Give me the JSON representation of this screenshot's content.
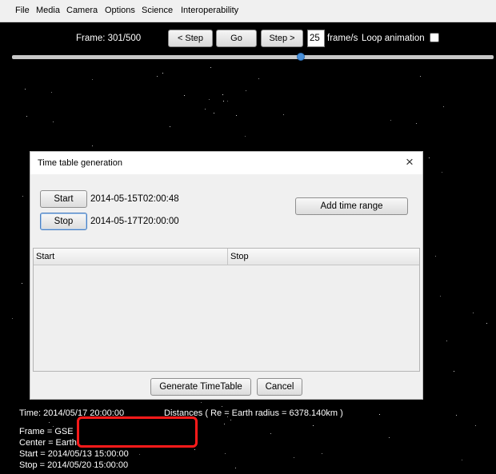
{
  "menubar": {
    "items": [
      "File",
      "Media",
      "Camera",
      "Options",
      "Science",
      "Interoperability"
    ]
  },
  "animation": {
    "frame_label": "Frame: 301/500",
    "step_back_label": "< Step",
    "go_label": "Go",
    "step_forward_label": "Step >",
    "fps_value": "25",
    "fps_unit": "frame/s",
    "loop_label": "Loop animation",
    "loop_checked": false,
    "progress_fraction": 0.6
  },
  "dialog": {
    "title": "Time table generation",
    "close_glyph": "×",
    "start_button": "Start",
    "start_value": "2014-05-15T02:00:48",
    "stop_button": "Stop",
    "stop_value": "2014-05-17T20:00:00",
    "add_range_button": "Add time range",
    "table": {
      "columns": [
        "Start",
        "Stop"
      ],
      "rows": []
    },
    "generate_button": "Generate TimeTable",
    "cancel_button": "Cancel"
  },
  "info": {
    "time": "Time: 2014/05/17 20:00:00",
    "distances": "Distances ( Re = Earth radius = 6378.140km )",
    "frame": "Frame = GSE",
    "center": "Center = Earth",
    "start": "Start = 2014/05/13 15:00:00",
    "stop": "Stop = 2014/05/20 15:00:00"
  },
  "colors": {
    "background": "#000000",
    "highlight": "#ff1a1a",
    "slider_thumb": "#4a90d9"
  }
}
